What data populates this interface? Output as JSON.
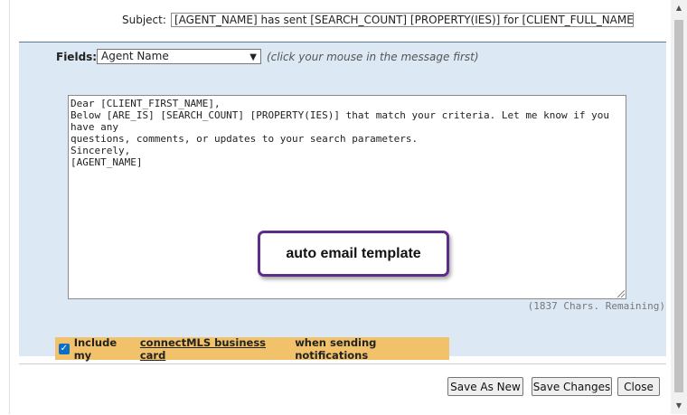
{
  "subject": {
    "label": "Subject:",
    "value": "[AGENT_NAME] has sent [SEARCH_COUNT] [PROPERTY(IES)] for [CLIENT_FULL_NAME] to"
  },
  "fields": {
    "label": "Fields:",
    "selected": "Agent Name",
    "hint": "(click your mouse in the message first)"
  },
  "message": {
    "lines": [
      "Dear [CLIENT_FIRST_NAME],",
      "",
      "Below [ARE_IS] [SEARCH_COUNT] [PROPERTY(IES)] that match your criteria. Let me know if you have any",
      "questions, comments, or updates to your search parameters.",
      "",
      "Sincerely,",
      "[AGENT_NAME]"
    ],
    "chars_remaining": "(1837 Chars. Remaining)"
  },
  "callout": {
    "text": "auto email template"
  },
  "business_card": {
    "checked": true,
    "prefix": "Include my",
    "link": "connectMLS business card",
    "suffix": "when sending notifications"
  },
  "buttons": {
    "save_as_new": "Save As New",
    "save_changes": "Save Changes",
    "close": "Close"
  },
  "colors": {
    "panel_bg": "#dce8f4",
    "highlight": "#f2c26a",
    "callout_border": "#5c2d8a",
    "checkbox": "#0b6fc9"
  }
}
